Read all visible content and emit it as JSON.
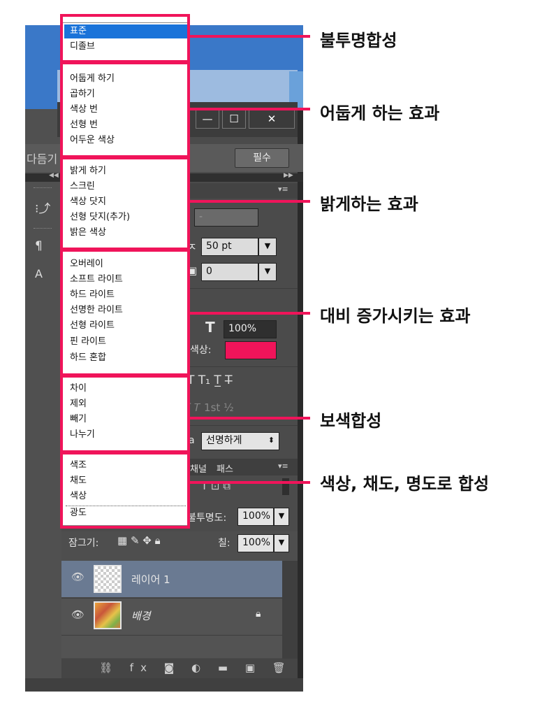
{
  "blend_modes": {
    "group_normal": [
      "표준",
      "디졸브"
    ],
    "group_darken": [
      "어둡게 하기",
      "곱하기",
      "색상 번",
      "선형 번",
      "어두운 색상"
    ],
    "group_lighten": [
      "밝게 하기",
      "스크린",
      "색상 닷지",
      "선형 닷지(추가)",
      "밝은 색상"
    ],
    "group_contrast": [
      "오버레이",
      "소프트 라이트",
      "하드 라이트",
      "선명한 라이트",
      "선형 라이트",
      "핀 라이트",
      "하드 혼합"
    ],
    "group_inversion": [
      "차이",
      "제외",
      "빼기",
      "나누기"
    ],
    "group_component": [
      "색조",
      "채도",
      "색상",
      "광도"
    ]
  },
  "annotations": {
    "normal": "불투명합성",
    "darken": "어둡게 하는 효과",
    "lighten": "밝게하는 효과",
    "contrast": "대비 증가시키는 효과",
    "inversion": "보색합성",
    "component": "색상, 채도, 명도로 합성"
  },
  "annotation_color": "#f0145a",
  "window": {
    "minimize": "—",
    "maximize": "☐",
    "close": "✕",
    "workspace_label": "필수",
    "left_label": "다듬기"
  },
  "character_panel": {
    "font_size": "50 pt",
    "tracking": "0",
    "scale": "100%",
    "color_label": "색상:",
    "text_color": "#f0145a",
    "antialias_label": "a",
    "antialias": "선명하게"
  },
  "layers_panel": {
    "tabs": [
      "채널",
      "패스"
    ],
    "opacity_label": "불투명도:",
    "opacity": "100%",
    "lock_label": "잠그기:",
    "fill_label": "칠:",
    "fill": "100%",
    "layers": [
      {
        "name": "레이어 1",
        "selected": true
      },
      {
        "name": "배경",
        "selected": false
      }
    ]
  }
}
